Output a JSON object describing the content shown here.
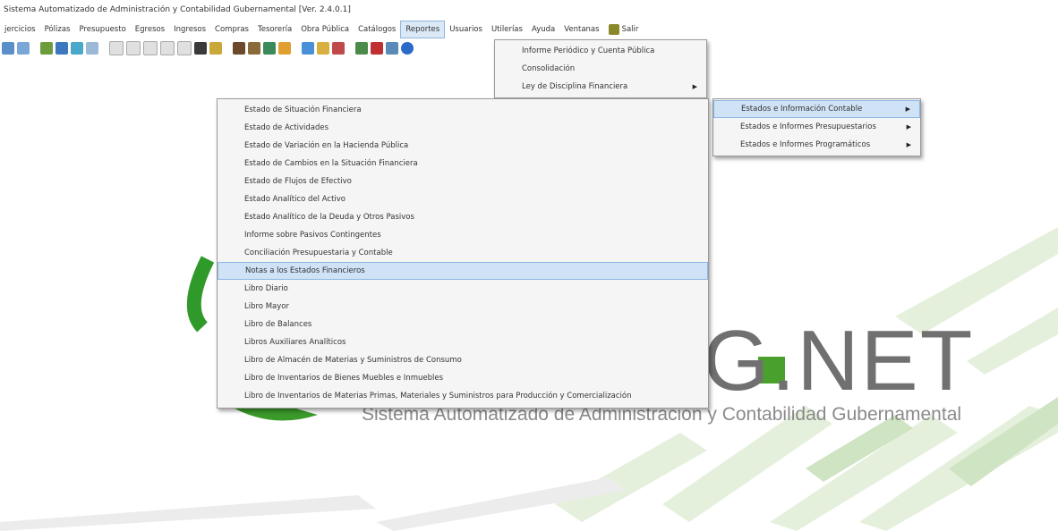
{
  "window": {
    "title": "Sistema Automatizado de Administración y Contabilidad Gubernamental [Ver. 2.4.0.1]"
  },
  "menubar": [
    "jercicios",
    "Pólizas",
    "Presupuesto",
    "Egresos",
    "Ingresos",
    "Compras",
    "Tesorería",
    "Obra Pública",
    "Catálogos",
    "Reportes",
    "Usuarios",
    "Utilerías",
    "Ayuda",
    "Ventanas",
    "Salir"
  ],
  "reportes_menu": [
    {
      "label": "Informe Periódico y Cuenta Pública",
      "submenu": false
    },
    {
      "label": "Consolidación",
      "submenu": false
    },
    {
      "label": "Ley de Disciplina Financiera",
      "submenu": true
    }
  ],
  "contables_menu": [
    {
      "label": "Estados e Información Contable",
      "submenu": true,
      "highlighted": true
    },
    {
      "label": "Estados e Informes Presupuestarios",
      "submenu": true
    },
    {
      "label": "Estados e Informes Programáticos",
      "submenu": true
    }
  ],
  "estados_menu": [
    "Estado de Situación Financiera",
    "Estado de Actividades",
    "Estado de Variación en la Hacienda Pública",
    "Estado de Cambios en la Situación Financiera",
    "Estado de Flujos de Efectivo",
    "Estado Analítico del Activo",
    "Estado Analítico de la Deuda y Otros Pasivos",
    "Informe sobre Pasivos Contingentes",
    "Conciliación Presupuestaria y Contable",
    "Notas a los Estados Financieros",
    "Libro Diario",
    "Libro Mayor",
    "Libro de Balances",
    "Libros Auxiliares Analíticos",
    "Libro de Almacén de Materias y Suministros de Consumo",
    "Libro de Inventarios de Bienes Muebles e Inmuebles",
    "Libro de Inventarios de Materias Primas, Materiales y Suministros para Producción y Comercialización"
  ],
  "estados_highlighted_index": 9,
  "background": {
    "logo_text": "G.NET",
    "tagline": "Sistema Automatizado de Administración y Contabilidad Gubernamental"
  },
  "colors": {
    "accent_green": "#4aa02c",
    "highlight": "#cfe2f6"
  }
}
